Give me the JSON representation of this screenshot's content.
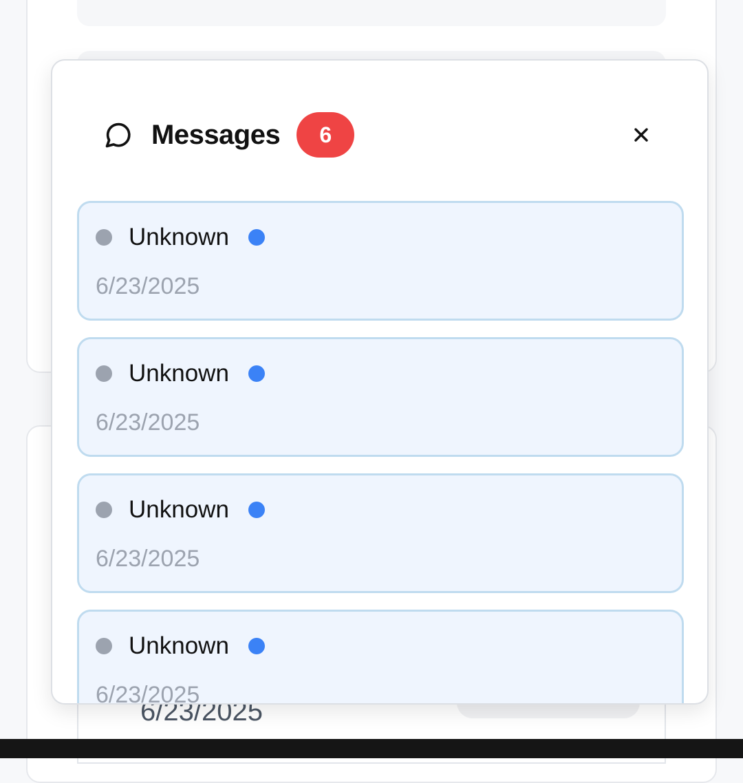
{
  "background": {
    "row_date": "6/23/2025"
  },
  "panel": {
    "title": "Messages",
    "count": "6",
    "icon": "chat-bubble-icon",
    "close_icon": "close-icon",
    "close_label": "×"
  },
  "messages": [
    {
      "sender": "Unknown",
      "date": "6/23/2025"
    },
    {
      "sender": "Unknown",
      "date": "6/23/2025"
    },
    {
      "sender": "Unknown",
      "date": "6/23/2025"
    },
    {
      "sender": "Unknown",
      "date": "6/23/2025"
    }
  ],
  "colors": {
    "badge": "#ef4444",
    "unread": "#3b82f6",
    "status": "#9ca3af",
    "item_bg": "#eff5fe",
    "item_border": "#bfdbef"
  }
}
